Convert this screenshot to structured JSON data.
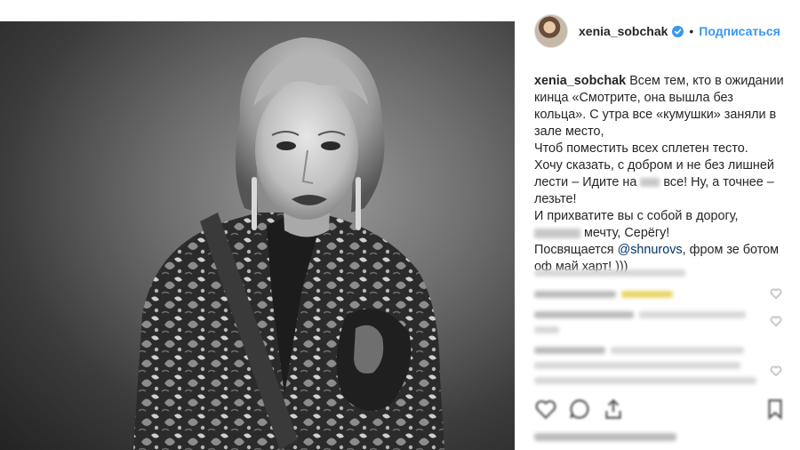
{
  "post": {
    "username": "xenia_sobchak",
    "verified": true,
    "follow_label": "Подписаться",
    "separator": "•"
  },
  "caption": {
    "username": "xenia_sobchak",
    "line1": "Всем тем, кто в ожидании",
    "line2": "кинца «Смотрите, она вышла без",
    "line3": "кольца». С утра все «кумушки» заняли в",
    "line4": "зале место,",
    "line5": "Чтоб поместить всех сплетен тесто.",
    "line6": "Хочу сказать, с добром и не без лишней",
    "line7a": "лести – Идите на",
    "line7b": "все! Ну, а точнее –",
    "line8": "лезьте!",
    "line9": "И прихватите вы с собой в дорогу,",
    "line10b": "мечту, Серёгу!",
    "line11a": "Посвящается",
    "mention": "@shnurovs",
    "line11b": ", фром зе ботом",
    "line12": "оф май харт! )))"
  },
  "icons": {
    "verified": "verified-badge-icon",
    "like": "heart-icon",
    "comment": "comment-icon",
    "share": "share-icon",
    "save": "bookmark-icon"
  },
  "colors": {
    "accent": "#3897f0",
    "mention": "#003569",
    "text": "#262626"
  }
}
